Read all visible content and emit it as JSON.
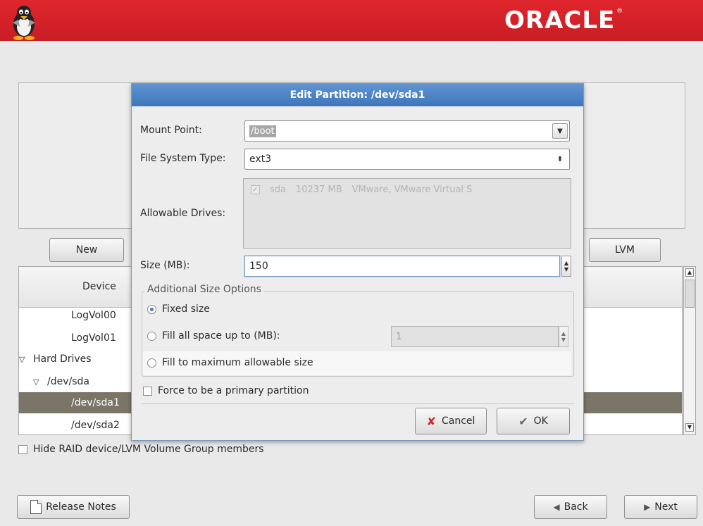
{
  "banner": {
    "logo_text": "ORACLE",
    "logo_mark": "®",
    "color": "#d8242b"
  },
  "background": {
    "new_label": "New",
    "lvm_label": "LVM",
    "tree_header": "Device",
    "tree_rows": [
      {
        "label": "LogVol00",
        "indent": 2,
        "twisty": "",
        "selected": false
      },
      {
        "label": "LogVol01",
        "indent": 2,
        "twisty": "",
        "selected": false
      },
      {
        "label": "Hard Drives",
        "indent": 0,
        "twisty": "▽",
        "selected": false
      },
      {
        "label": "/dev/sda",
        "indent": 1,
        "twisty": "▽",
        "selected": false
      },
      {
        "label": "/dev/sda1",
        "indent": 2,
        "twisty": "",
        "selected": true
      },
      {
        "label": "/dev/sda2",
        "indent": 2,
        "twisty": "",
        "selected": false
      }
    ],
    "hide_raid_label": "Hide RAID device/LVM Volume Group members",
    "release_notes_label": "Release Notes",
    "back_label": "Back",
    "next_label": "Next"
  },
  "dialog": {
    "title": "Edit Partition: /dev/sda1",
    "mount_point_label": "Mount Point:",
    "mount_point_value": "/boot",
    "fs_type_label": "File System Type:",
    "fs_type_value": "ext3",
    "allowable_drives_label": "Allowable Drives:",
    "drive": {
      "name": "sda",
      "size": "10237 MB",
      "model": "VMware, VMware Virtual S",
      "checked": true
    },
    "size_label": "Size (MB):",
    "size_value": "150",
    "size_options_legend": "Additional Size Options",
    "radio_fixed": "Fixed size",
    "radio_fill_up": "Fill all space up to (MB):",
    "fill_up_value": "1",
    "radio_fill_max": "Fill to maximum allowable size",
    "selected_size_option": "fixed",
    "force_primary_label": "Force to be a primary partition",
    "cancel_label": "Cancel",
    "ok_label": "OK",
    "title_color": "#4a82c4"
  }
}
